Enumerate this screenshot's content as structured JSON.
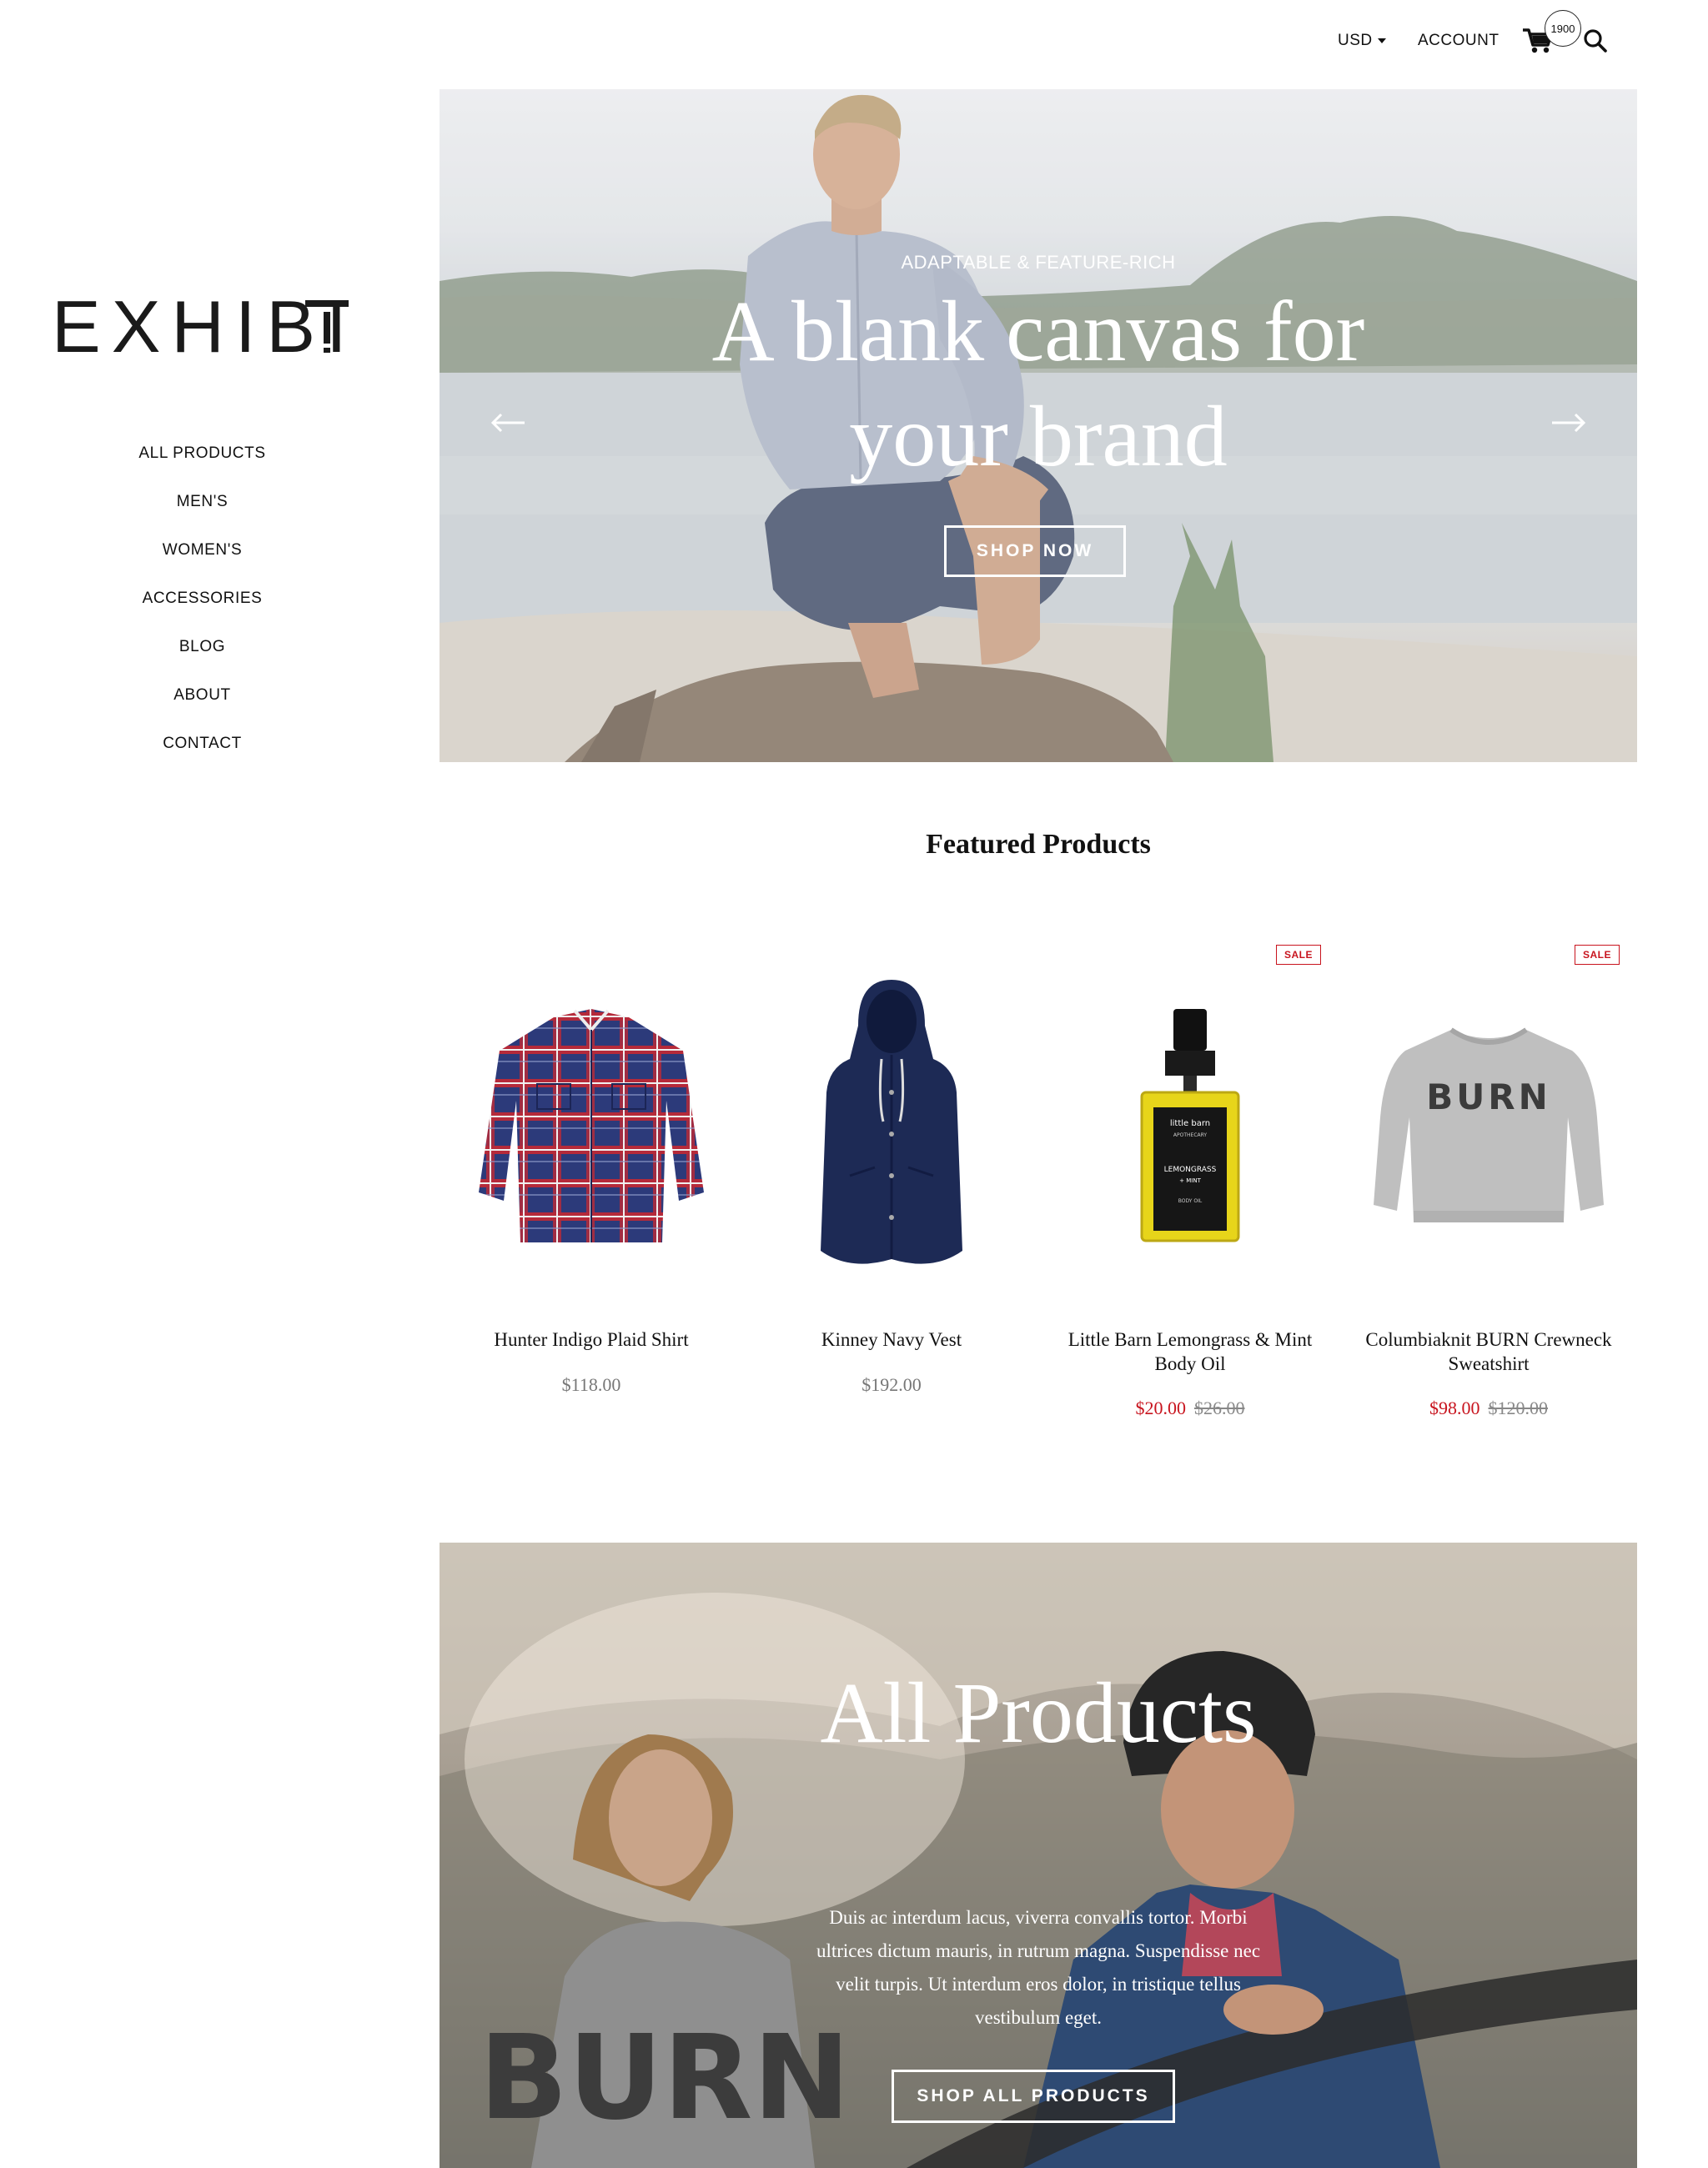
{
  "header": {
    "currency": "USD",
    "account_label": "ACCOUNT",
    "cart_count": "1900"
  },
  "brand": {
    "logo_text": "EXHIBIT"
  },
  "nav": {
    "items": [
      {
        "label": "ALL PRODUCTS"
      },
      {
        "label": "MEN'S"
      },
      {
        "label": "WOMEN'S"
      },
      {
        "label": "ACCESSORIES"
      },
      {
        "label": "BLOG"
      },
      {
        "label": "ABOUT"
      },
      {
        "label": "CONTACT"
      }
    ]
  },
  "hero": {
    "kicker": "ADAPTABLE & FEATURE-RICH",
    "title": "A blank canvas for your brand",
    "button_label": "SHOP NOW",
    "prev_icon": "arrow-left-icon",
    "next_icon": "arrow-right-icon"
  },
  "featured": {
    "title": "Featured Products",
    "products": [
      {
        "name": "Hunter Indigo Plaid Shirt",
        "price": "$118.00",
        "sale_price": "",
        "compare_price": "",
        "badge": "",
        "image": "plaid-shirt-image"
      },
      {
        "name": "Kinney Navy Vest",
        "price": "$192.00",
        "sale_price": "",
        "compare_price": "",
        "badge": "",
        "image": "navy-vest-image"
      },
      {
        "name": "Little Barn Lemongrass & Mint Body Oil",
        "price": "",
        "sale_price": "$20.00",
        "compare_price": "$26.00",
        "badge": "SALE",
        "image": "body-oil-image",
        "bottle_label": {
          "brand": "little barn",
          "sub": "APOTHECARY",
          "product": "LEMONGRASS",
          "product2": "+ MINT",
          "type": "BODY OIL"
        }
      },
      {
        "name": "Columbiaknit BURN Crewneck Sweatshirt",
        "price": "",
        "sale_price": "$98.00",
        "compare_price": "$120.00",
        "badge": "SALE",
        "image": "sweatshirt-image",
        "print_text": "BURN"
      }
    ]
  },
  "collection_banner": {
    "title": "All Products",
    "text": "Duis ac interdum lacus, viverra convallis tortor. Morbi ultrices dictum mauris, in rutrum magna. Suspendisse nec velit turpis. Ut interdum eros dolor, in tristique tellus vestibulum eget.",
    "button_label": "SHOP ALL PRODUCTS",
    "shirt_print": "BURN"
  },
  "colors": {
    "sale_red": "#c8141e",
    "text_dark": "#111111",
    "price_gray": "#777777"
  }
}
